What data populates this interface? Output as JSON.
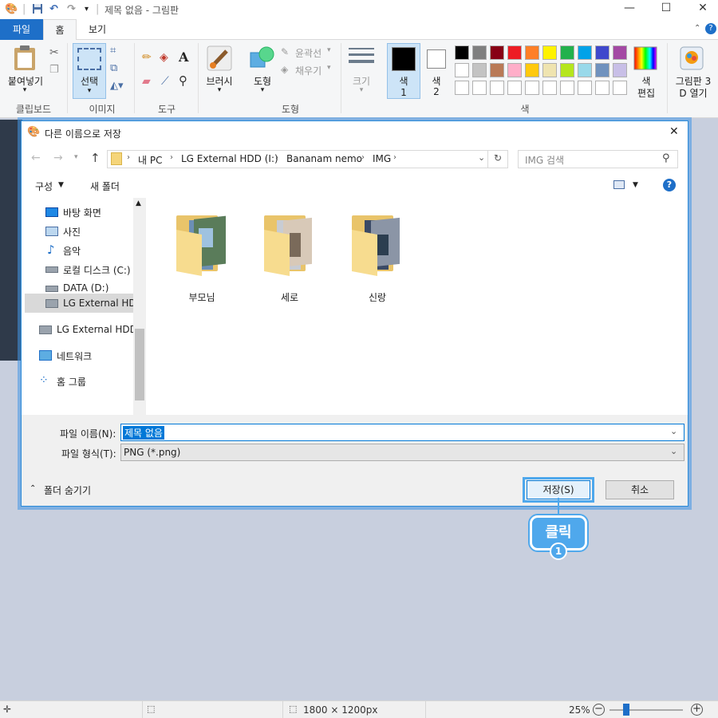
{
  "app": {
    "title": "제목 없음 - 그림판",
    "minimize_glyph": "—",
    "maximize_glyph": "☐",
    "close_glyph": "✕"
  },
  "ribbon_tabs": {
    "file": "파일",
    "home": "홈",
    "view": "보기"
  },
  "ribbon": {
    "clipboard": {
      "paste": "붙여넣기",
      "group": "클립보드"
    },
    "image": {
      "select": "선택",
      "group": "이미지"
    },
    "tools": {
      "group": "도구"
    },
    "brushes": {
      "label": "브러시"
    },
    "shapes": {
      "label": "도형",
      "outline": "윤곽선",
      "fill": "채우기",
      "group": "도형"
    },
    "size": {
      "label": "크기"
    },
    "color1": {
      "line1": "색",
      "line2": "1"
    },
    "color2": {
      "line1": "색",
      "line2": "2"
    },
    "edit_colors": {
      "line1": "색",
      "line2": "편집"
    },
    "paint3d": {
      "line1": "그림판 3",
      "line2": "D 열기"
    },
    "colors_group": "색",
    "palette_row1": [
      "#000000",
      "#7f7f7f",
      "#880015",
      "#ed1c24",
      "#ff7f27",
      "#fff200",
      "#22b14c",
      "#00a2e8",
      "#3f48cc",
      "#a349a4"
    ],
    "palette_row2": [
      "#ffffff",
      "#c3c3c3",
      "#b97a57",
      "#ffaec9",
      "#ffc90e",
      "#efe4b0",
      "#b5e61d",
      "#99d9ea",
      "#7092be",
      "#c8bfe7"
    ],
    "palette_row3": [
      "#ffffff",
      "#ffffff",
      "#ffffff",
      "#ffffff",
      "#ffffff",
      "#ffffff",
      "#ffffff",
      "#ffffff",
      "#ffffff",
      "#ffffff"
    ]
  },
  "dialog": {
    "title": "다른 이름으로 저장",
    "breadcrumb": [
      "내 PC",
      "LG External HDD (I:)",
      "Bananam nemo",
      "IMG"
    ],
    "search_placeholder": "IMG 검색",
    "organize": "구성",
    "new_folder": "새 폴더",
    "help_glyph": "?",
    "nav_items": [
      {
        "label": "바탕 화면"
      },
      {
        "label": "사진"
      },
      {
        "label": "음악"
      },
      {
        "label": "로컬 디스크 (C:)"
      },
      {
        "label": "DATA (D:)"
      },
      {
        "label": "LG External HDD"
      },
      {
        "label": "LG External HDD"
      },
      {
        "label": "네트워크"
      },
      {
        "label": "홈 그룹"
      }
    ],
    "folders": [
      {
        "name": "부모님"
      },
      {
        "name": "세로"
      },
      {
        "name": "신랑"
      }
    ],
    "filename_label": "파일 이름(N):",
    "filename_value": "제목 없음",
    "filetype_label": "파일 형식(T):",
    "filetype_value": "PNG (*.png)",
    "hide_folders": "폴더 숨기기",
    "save_button": "저장(S)",
    "cancel_button": "취소"
  },
  "statusbar": {
    "dimensions": "1800 × 1200px",
    "zoom": "25%",
    "zoom_fraction": 0.23
  },
  "callout": {
    "text": "클릭",
    "number": "1"
  },
  "colors": {
    "accent": "#1e6fc8",
    "callout": "#4fa8ec",
    "selection": "#0078d7"
  }
}
